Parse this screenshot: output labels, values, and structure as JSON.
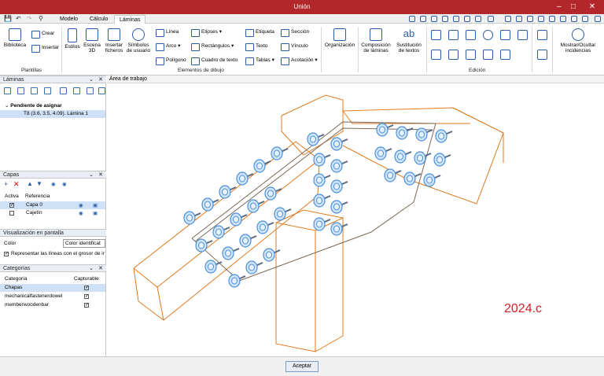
{
  "window": {
    "title": "Unión"
  },
  "tabs": [
    "Modelo",
    "Cálculo",
    "Láminas"
  ],
  "active_tab": "Láminas",
  "ribbon": {
    "plantillas": {
      "biblioteca": "Biblioteca",
      "crear": "Crear",
      "insertar": "Insertar",
      "group": "Plantillas"
    },
    "estilos": "Estilos",
    "escena3d": [
      "Escena",
      "3D"
    ],
    "insertar_ficheros": [
      "Insertar",
      "ficheros"
    ],
    "simbolos_usuario": [
      "Símbolos",
      "de usuario"
    ],
    "linea": "Línea",
    "arco": "Arco",
    "poligono": "Polígono",
    "elipses": "Elipses",
    "rectangulos": "Rectángulos",
    "cuadro_texto": "Cuadro de texto",
    "etiqueta": "Etiqueta",
    "texto": "Texto",
    "tablas": "Tablas",
    "seccion": "Sección",
    "vinculo": "Vínculo",
    "acotacion": "Acotación",
    "elementos_group": "Elementos de dibujo",
    "organizacion": "Organización",
    "composicion": [
      "Composición",
      "de láminas"
    ],
    "sustitucion": [
      "Sustitución",
      "de textos"
    ],
    "edicion_group": "Edición",
    "mostrar": [
      "Mostrar/Ocultar",
      "incidencias"
    ]
  },
  "laminas_panel": {
    "title": "Láminas",
    "group": "Pendiente de asignar",
    "item": "T8 (3.6, 3.5, 4.09). Lámina 1"
  },
  "capas_panel": {
    "title": "Capas",
    "columns": [
      "Activa",
      "Referencia"
    ],
    "rows": [
      {
        "checked": true,
        "name": "Capa 0"
      },
      {
        "checked": false,
        "name": "Cajetín"
      }
    ]
  },
  "visualizacion_panel": {
    "title": "Visualización en pantalla",
    "color_label": "Color",
    "color_value": "Color identificat",
    "checkbox_label": "Representar las líneas con el grosor de ir"
  },
  "categorias_panel": {
    "title": "Categorías",
    "columns": [
      "Categoría",
      "Capturable"
    ],
    "rows": [
      {
        "name": "Chapas",
        "checked": true
      },
      {
        "name": "mechanicalfastenerdowel",
        "checked": true
      },
      {
        "name": "memberwoodenbar",
        "checked": true
      }
    ]
  },
  "workspace": {
    "title": "Área de trabajo",
    "watermark": "2024.c"
  },
  "footer": {
    "accept": "Aceptar"
  },
  "colors": {
    "titlebar": "#b3262a",
    "wood_edges": "#e07a1f",
    "fasteners": "#4a90d9",
    "watermark": "#d0202a"
  }
}
